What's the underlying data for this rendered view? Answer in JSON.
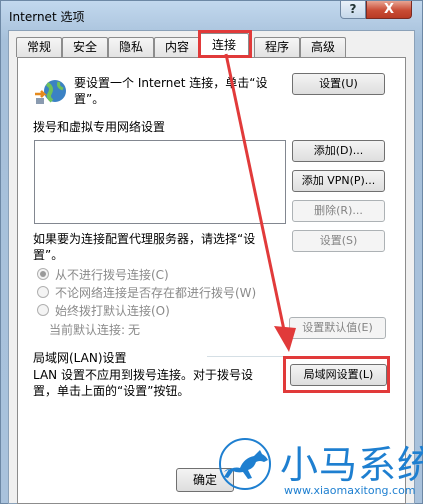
{
  "window": {
    "title": "Internet 选项",
    "help_glyph": "?",
    "close_glyph": "X"
  },
  "tabs": [
    {
      "label": "常规"
    },
    {
      "label": "安全"
    },
    {
      "label": "隐私"
    },
    {
      "label": "内容"
    },
    {
      "label": "连接"
    },
    {
      "label": "程序"
    },
    {
      "label": "高级"
    }
  ],
  "connection": {
    "setup_text": "要设置一个 Internet 连接，单击“设置”。",
    "setup_button": "设置(U)",
    "dialup_section": "拨号和虚拟专用网络设置",
    "add_button": "添加(D)...",
    "add_vpn_button": "添加 VPN(P)...",
    "delete_button": "删除(R)...",
    "proxy_text": "如果要为连接配置代理服务器，请选择“设置”。",
    "settings_button": "设置(S)",
    "radio_never": "从不进行拨号连接(C)",
    "radio_when_none": "不论网络连接是否存在都进行拨号(W)",
    "radio_always": "始终拨打默认连接(O)",
    "current_default_label": "当前默认连接:",
    "current_default_value": "无",
    "set_default_button": "设置默认值(E)",
    "lan_section": "局域网(LAN)设置",
    "lan_text": "LAN 设置不应用到拨号连接。对于拨号设置，单击上面的“设置”按钮。",
    "lan_button": "局域网设置(L)"
  },
  "footer": {
    "ok_button": "确定"
  },
  "watermark": {
    "brand": "小马系统",
    "url": "www.xiaomaxitong.com"
  },
  "colors": {
    "highlight": "#e13a3a",
    "watermark": "#1e7fd0"
  }
}
